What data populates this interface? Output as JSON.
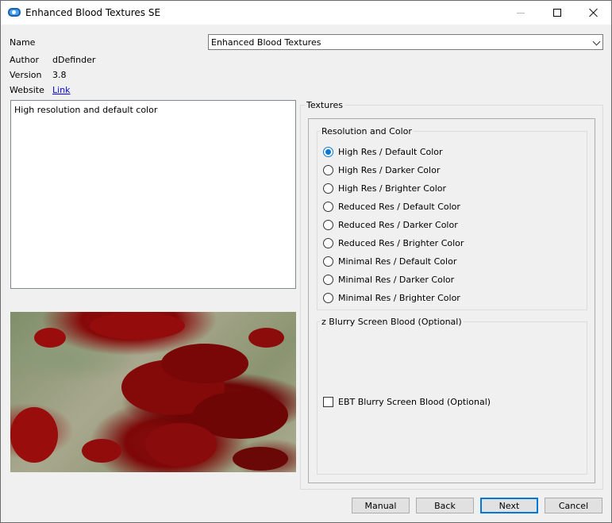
{
  "window": {
    "title": "Enhanced Blood Textures SE",
    "controls": [
      "minimize-icon",
      "maximize-icon",
      "close-icon"
    ]
  },
  "info": {
    "name_label": "Name",
    "name_value": "Enhanced Blood Textures",
    "author_label": "Author",
    "author_value": "dDefinder",
    "version_label": "Version",
    "version_value": "3.8",
    "website_label": "Website",
    "website_link": "Link"
  },
  "description": "High resolution and default color",
  "textures": {
    "group_title": "Textures",
    "resolution_group": {
      "title": "Resolution and Color",
      "options": [
        {
          "label": "High Res / Default Color",
          "checked": true
        },
        {
          "label": "High Res / Darker Color",
          "checked": false
        },
        {
          "label": "High Res / Brighter Color",
          "checked": false
        },
        {
          "label": "Reduced Res / Default Color",
          "checked": false
        },
        {
          "label": "Reduced Res / Darker Color",
          "checked": false
        },
        {
          "label": "Reduced Res / Brighter Color",
          "checked": false
        },
        {
          "label": "Minimal Res / Default Color",
          "checked": false
        },
        {
          "label": "Minimal Res / Darker Color",
          "checked": false
        },
        {
          "label": "Minimal Res / Brighter Color",
          "checked": false
        }
      ]
    },
    "blurry_group": {
      "title": "z Blurry Screen Blood (Optional)",
      "checkbox_label": "EBT Blurry Screen Blood (Optional)",
      "checked": false
    }
  },
  "buttons": {
    "manual": "Manual",
    "back": "Back",
    "next": "Next",
    "cancel": "Cancel"
  },
  "colors": {
    "accent": "#0078d7",
    "link": "#0000ee",
    "blood": "#8f0a0a"
  }
}
